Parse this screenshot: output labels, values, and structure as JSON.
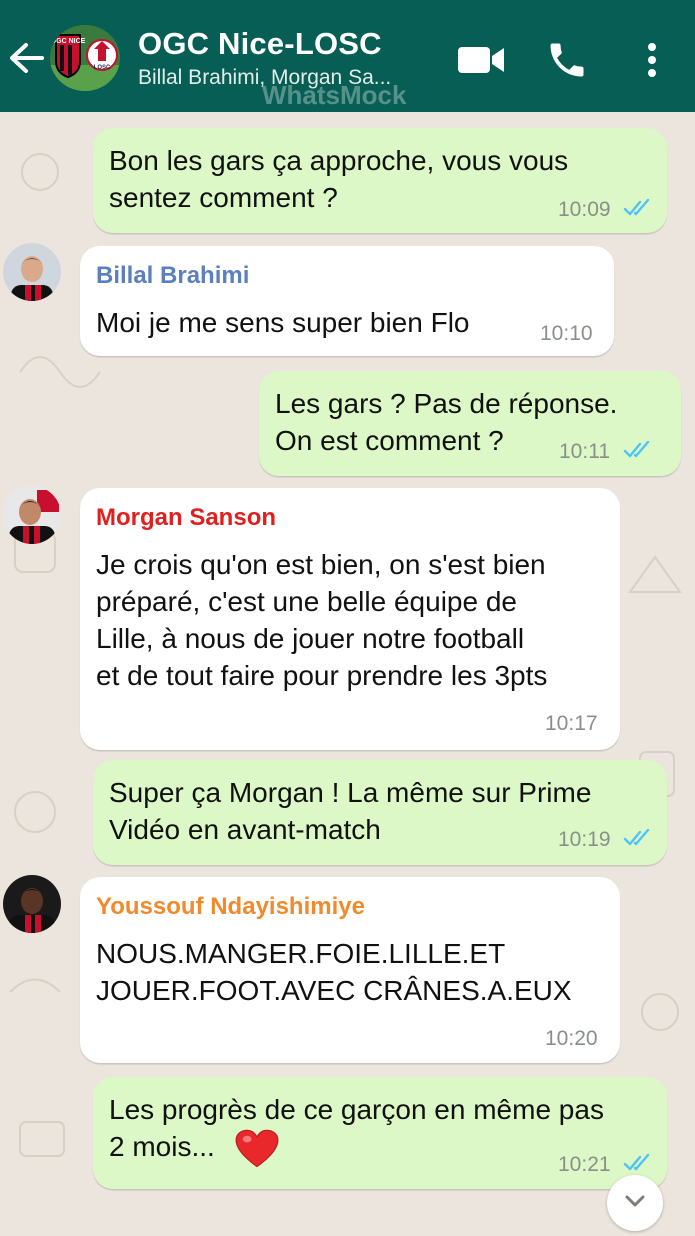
{
  "header": {
    "title": "OGC Nice-LOSC",
    "subtitle": "Billal Brahimi, Morgan Sa...",
    "watermark": "WhatsMock",
    "avatar_text": "OGC NICE",
    "avatar_text2": "LOSC",
    "icons": [
      "back-arrow-icon",
      "video-call-icon",
      "phone-icon",
      "more-vert-icon"
    ]
  },
  "colors": {
    "header": "#075e54",
    "outgoing_bubble": "#dcf8c6",
    "incoming_bubble": "#ffffff",
    "read_ticks": "#4fc3f7",
    "billal": "#5b7fbf",
    "morgan": "#e02020",
    "youssouf": "#f08a2c",
    "heart": "#e8282b"
  },
  "messages": [
    {
      "direction": "out",
      "text": "Bon les gars ça approche, vous vous\nsentez comment ?",
      "time": "10:09",
      "status": "read"
    },
    {
      "direction": "in",
      "sender": "Billal Brahimi",
      "text": "Moi je me sens super bien Flo",
      "time": "10:10"
    },
    {
      "direction": "out",
      "text": "Les gars ? Pas de réponse.\nOn est comment ?",
      "time": "10:11",
      "status": "read"
    },
    {
      "direction": "in",
      "sender": "Morgan Sanson",
      "text": "Je crois qu'on est bien, on s'est bien\npréparé, c'est une belle équipe de\nLille, à nous de jouer notre football\net de tout faire pour prendre les 3pts",
      "time": "10:17"
    },
    {
      "direction": "out",
      "text": "Super ça Morgan ! La même sur Prime\nVidéo en avant-match",
      "time": "10:19",
      "status": "read"
    },
    {
      "direction": "in",
      "sender": "Youssouf Ndayishimiye",
      "text": "NOUS.MANGER.FOIE.LILLE.ET\nJOUER.FOOT.AVEC CRÂNES.A.EUX",
      "time": "10:20"
    },
    {
      "direction": "out",
      "text": "Les progrès de ce garçon en même pas\n2 mois...",
      "emoji": "heart-emoji",
      "time": "10:21",
      "status": "read"
    }
  ]
}
